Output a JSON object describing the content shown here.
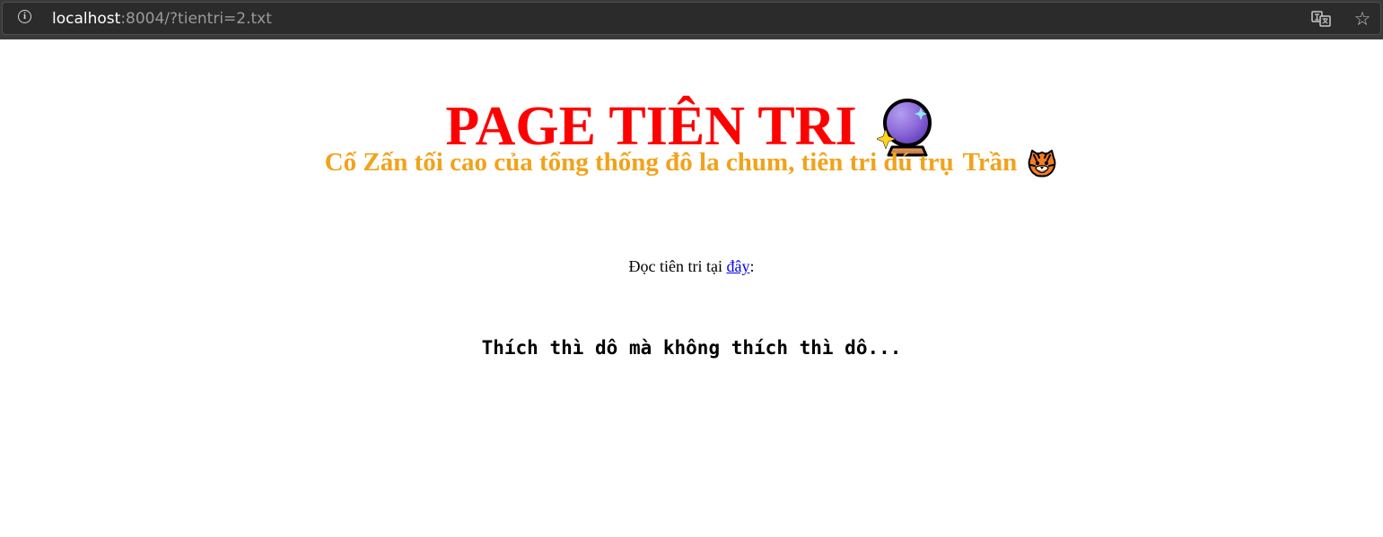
{
  "browser": {
    "url_host": "localhost",
    "url_rest": ":8004/?tientri=2.txt",
    "icons": {
      "site_info": "info-icon",
      "translate": "translate-icon",
      "bookmark": "star-icon"
    }
  },
  "page": {
    "title": "PAGE TIÊN TRI",
    "title_icon": "crystal-ball-icon",
    "subtitle_prefix": "Cố Zấn tối cao của tổng thống đô la chum, tiên tri dú trụ",
    "subtitle_name": "Trần",
    "subtitle_icon": "tiger-icon",
    "read_prefix": "Đọc tiên tri tại",
    "read_link": "đây",
    "read_suffix": ":",
    "prophecy": "Thích thì dô mà không thích thì dô..."
  },
  "colors": {
    "title": "#ff0000",
    "subtitle": "#f2a21a",
    "link": "#0000ee",
    "chrome_background": "#3a3a3a",
    "omnibox_background": "#2b2b2b"
  }
}
